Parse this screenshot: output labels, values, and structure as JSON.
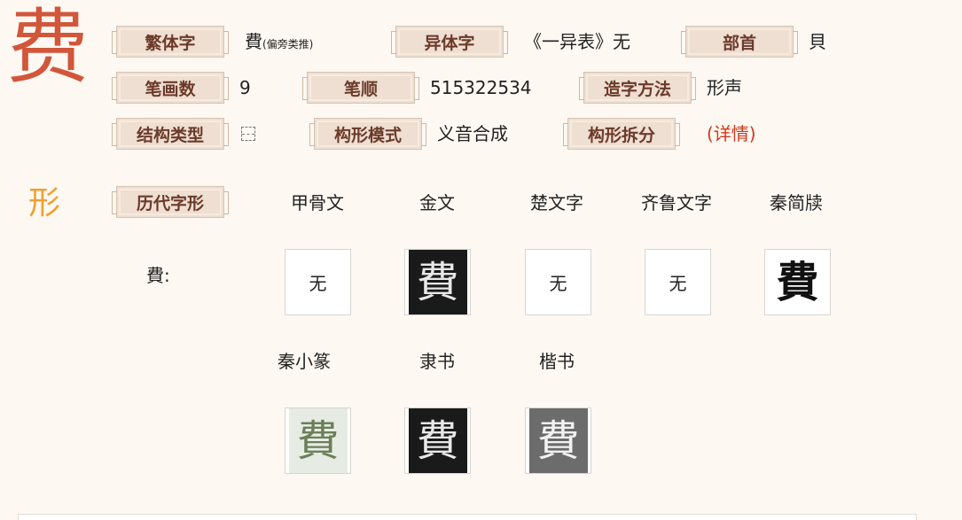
{
  "main_char": "费",
  "rows": [
    [
      {
        "label": "繁体字",
        "value": "費",
        "note": "(偏旁类推)"
      },
      {
        "label": "异体字",
        "value": "《一异表》无"
      },
      {
        "label": "部首",
        "value": "貝"
      }
    ],
    [
      {
        "label": "笔画数",
        "value": "9"
      },
      {
        "label": "笔顺",
        "value": "515322534"
      },
      {
        "label": "造字方法",
        "value": "形声"
      }
    ],
    [
      {
        "label": "结构类型",
        "value": "",
        "icon": "top-bottom-structure-icon"
      },
      {
        "label": "构形模式",
        "value": "义音合成"
      },
      {
        "label": "构形拆分",
        "value": "(详情)"
      }
    ]
  ],
  "form_section": {
    "char": "形",
    "label": "历代字形",
    "glyph_label": "費:",
    "scripts_row1": [
      "甲骨文",
      "金文",
      "楚文字",
      "齐鲁文字",
      "秦简牍"
    ],
    "glyphs_row1": [
      "无",
      "費",
      "无",
      "无",
      "費"
    ],
    "scripts_row2": [
      "秦小篆",
      "隶书",
      "楷书"
    ],
    "glyphs_row2": [
      "費",
      "費",
      "費"
    ]
  },
  "colors": {
    "accent_red": "#d2563a",
    "accent_orange": "#f0a032",
    "label_bg": "#eedfd2",
    "label_text": "#6b3a2a",
    "link_red": "#d2381e"
  }
}
